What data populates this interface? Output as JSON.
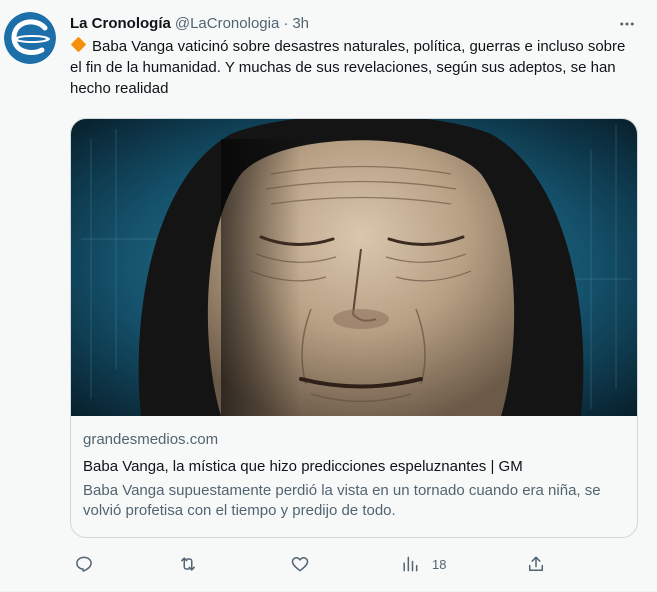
{
  "tweet": {
    "display_name": "La Cronología",
    "handle": "@LaCronologia",
    "separator": "·",
    "time": "3h",
    "text": "Baba Vanga vaticinó sobre desastres naturales, política, guerras e incluso sobre el fin de la humanidad. Y muchas de sus revelaciones, según sus adeptos, se han hecho realidad",
    "emoji": "orange-diamond-icon"
  },
  "card": {
    "domain": "grandesmedios.com",
    "title": "Baba Vanga, la mística que hizo predicciones espeluznantes | GM",
    "description": "Baba Vanga supuestamente perdió la vista en un tornado cuando era niña, se volvió profetisa con el tiempo y predijo de todo."
  },
  "actions": {
    "reply": {
      "icon": "reply-icon",
      "count": ""
    },
    "retweet": {
      "icon": "retweet-icon",
      "count": ""
    },
    "like": {
      "icon": "heart-icon",
      "count": ""
    },
    "views": {
      "icon": "analytics-icon",
      "count": "18"
    },
    "share": {
      "icon": "share-icon",
      "count": ""
    }
  },
  "colors": {
    "background": "#f7f9f9",
    "text_primary": "#0f1419",
    "text_secondary": "#536471",
    "border": "#cfd9de",
    "avatar_blue": "#1c6fa8",
    "emoji_orange": "#f4900c"
  }
}
